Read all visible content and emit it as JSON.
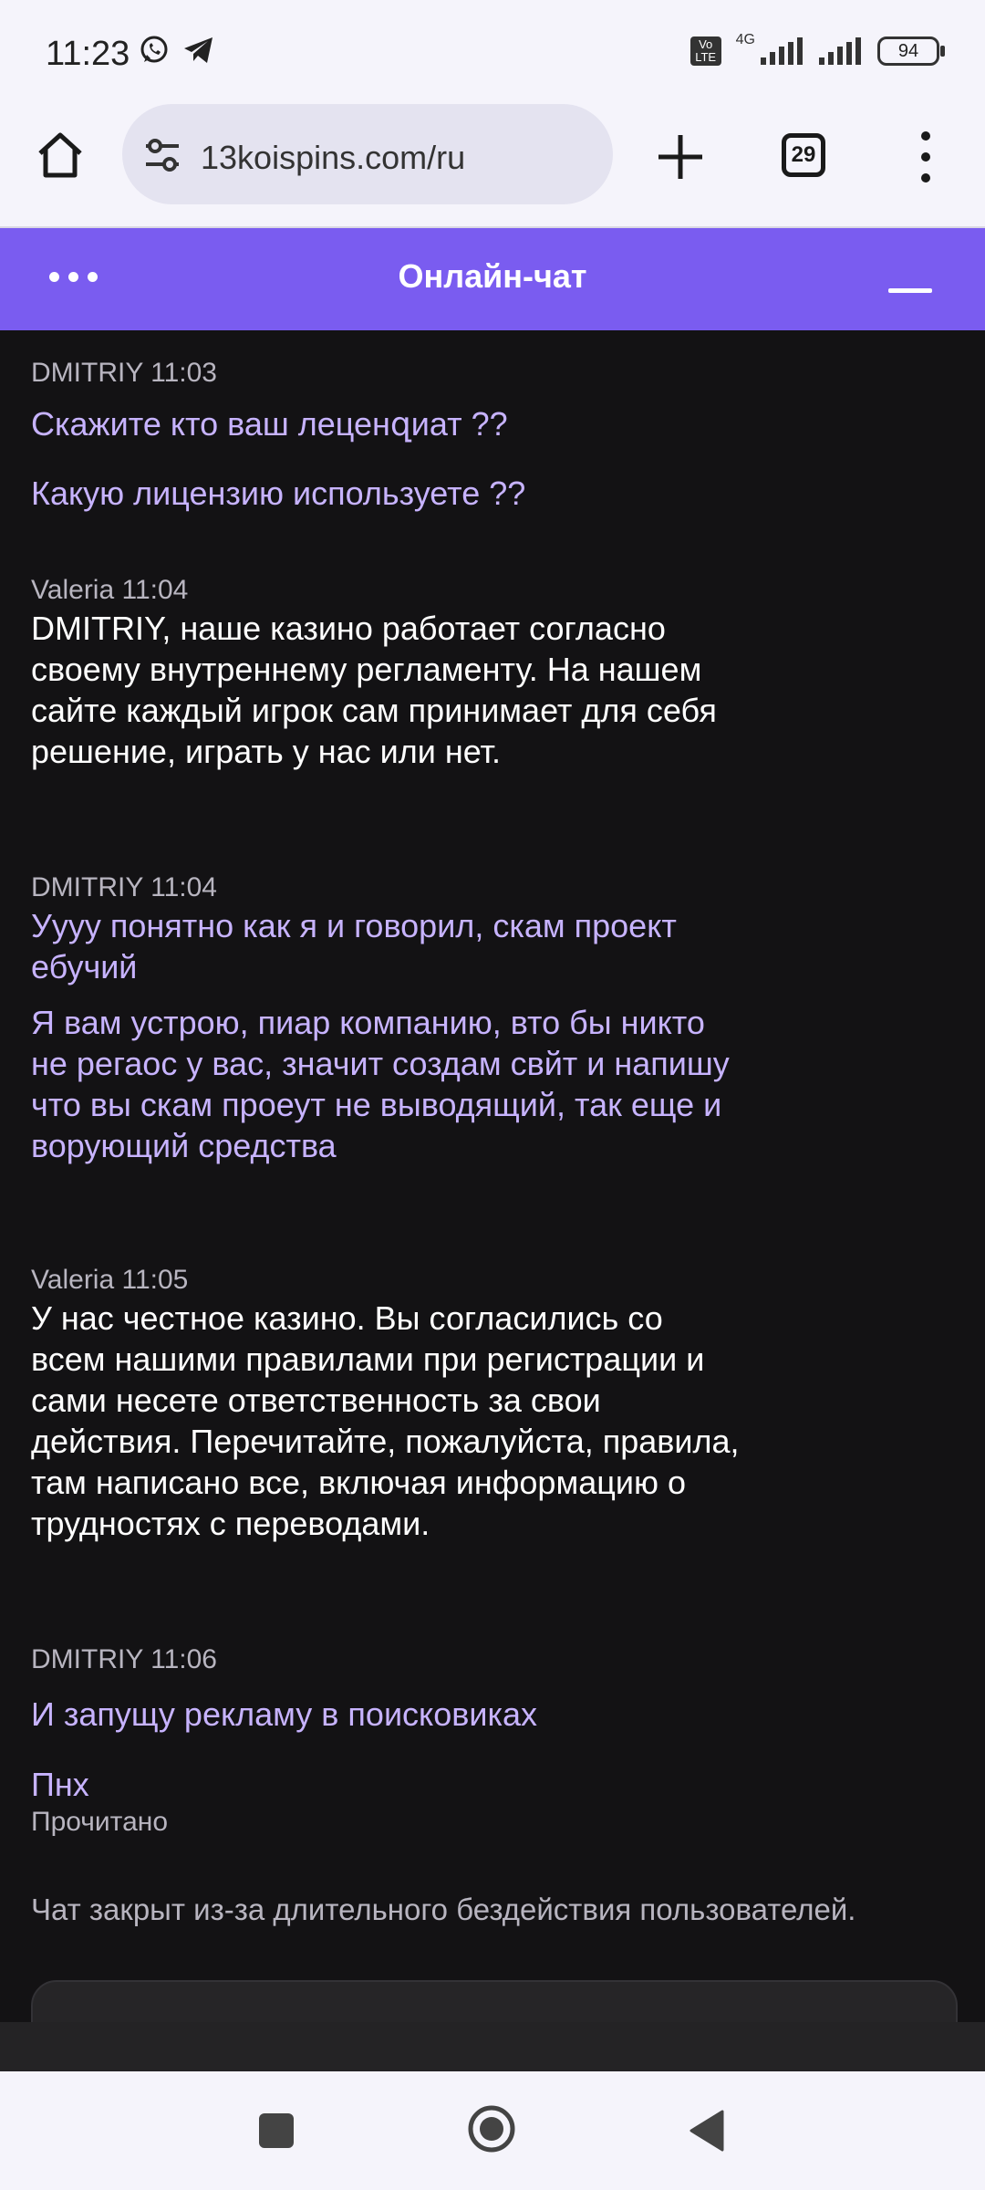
{
  "status_bar": {
    "time": "11:23",
    "network": "4G",
    "volte": "Vo LTE",
    "battery": "94"
  },
  "browser": {
    "url": "13koispins.com/ru",
    "tab_count": "29"
  },
  "chat": {
    "title": "Онлайн-чат",
    "messages": [
      {
        "meta": "DMITRIY 11:03",
        "texts": [
          "Скажите кто ваш леценզиат ??",
          "Какую лицензию используете ??"
        ]
      },
      {
        "meta": "Valeria 11:04",
        "texts": [
          "DMITRIY, наше казино работает согласно своему внутреннему регламенту. На нашем сайте каждый игрок сам принимает для себя решение, играть у нас или нет."
        ]
      },
      {
        "meta": "DMITRIY 11:04",
        "texts": [
          "Уууу понятно как я и говорил, скам проект ебучий",
          "Я вам устрою, пиар компанию, вто бы никто не регаос у вас, значит создам свйт и напишу что вы скам проеут не выводящий, так еще и ворующий средства"
        ]
      },
      {
        "meta": "Valeria 11:05",
        "texts": [
          "У нас честное казино. Вы согласились со всем нашими правилами при регистрации и сами несете ответственность за свои действия. Перечитайте, пожалуйста, правила, там написано все, включая информацию о трудностях с переводами."
        ]
      },
      {
        "meta": "DMITRIY 11:06",
        "texts": [
          "И запущу рекламу в поисковиках",
          "Пнх"
        ]
      }
    ],
    "read_status": "Прочитано",
    "closed_note": "Чат закрыт из-за длительного бездействия пользователей."
  }
}
